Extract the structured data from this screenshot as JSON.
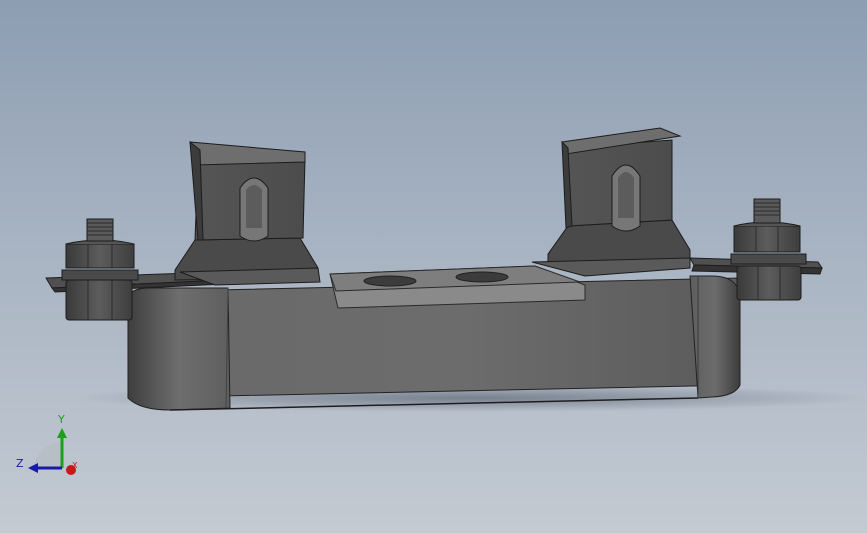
{
  "viewport": {
    "background_top": "#8d9db2",
    "background_bottom": "#c3cad2"
  },
  "triad": {
    "y_label": "Y",
    "z_label": "Z",
    "x_label": "X",
    "y_color": "#1aa01a",
    "z_color": "#1a1aa8",
    "x_color": "#c81818"
  }
}
